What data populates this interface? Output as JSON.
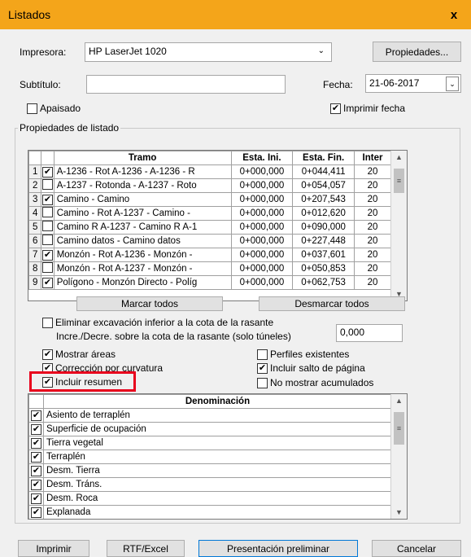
{
  "window": {
    "title": "Listados",
    "close_label": "x"
  },
  "printer": {
    "label": "Impresora:",
    "value": "HP LaserJet 1020",
    "properties_button": "Propiedades..."
  },
  "subtitle": {
    "label": "Subtítulo:",
    "value": ""
  },
  "date": {
    "label": "Fecha:",
    "value": "21-06-2017"
  },
  "landscape": {
    "label": "Apaisado",
    "checked": false
  },
  "print_date": {
    "label": "Imprimir fecha",
    "checked": true
  },
  "group_title": "Propiedades de listado",
  "tramo_table": {
    "headers": [
      "Tramo",
      "Esta. Ini.",
      "Esta. Fin.",
      "Inter"
    ],
    "rows": [
      {
        "n": "1",
        "checked": true,
        "tramo": "A-1236 - Rot A-1236 - A-1236 - R",
        "ini": "0+000,000",
        "fin": "0+044,411",
        "inter": "20"
      },
      {
        "n": "2",
        "checked": false,
        "tramo": "A-1237 - Rotonda - A-1237 - Roto",
        "ini": "0+000,000",
        "fin": "0+054,057",
        "inter": "20"
      },
      {
        "n": "3",
        "checked": true,
        "tramo": "Camino - Camino",
        "ini": "0+000,000",
        "fin": "0+207,543",
        "inter": "20"
      },
      {
        "n": "4",
        "checked": false,
        "tramo": "Camino - Rot A-1237 - Camino -",
        "ini": "0+000,000",
        "fin": "0+012,620",
        "inter": "20"
      },
      {
        "n": "5",
        "checked": false,
        "tramo": "Camino R A-1237 - Camino R A-1",
        "ini": "0+000,000",
        "fin": "0+090,000",
        "inter": "20"
      },
      {
        "n": "6",
        "checked": false,
        "tramo": "Camino datos - Camino datos",
        "ini": "0+000,000",
        "fin": "0+227,448",
        "inter": "20"
      },
      {
        "n": "7",
        "checked": true,
        "tramo": "Monzón - Rot A-1236 - Monzón -",
        "ini": "0+000,000",
        "fin": "0+037,601",
        "inter": "20"
      },
      {
        "n": "8",
        "checked": false,
        "tramo": "Monzón - Rot A-1237 - Monzón -",
        "ini": "0+000,000",
        "fin": "0+050,853",
        "inter": "20"
      },
      {
        "n": "9",
        "checked": true,
        "tramo": "Polígono - Monzón Directo - Políg",
        "ini": "0+000,000",
        "fin": "0+062,753",
        "inter": "20"
      }
    ]
  },
  "mark_all": "Marcar todos",
  "unmark_all": "Desmarcar todos",
  "excavation": {
    "line1": "Eliminar excavación inferior a la cota de la rasante",
    "line2": "Incre./Decre. sobre la cota de la rasante (solo túneles)",
    "value": "0,000",
    "checked": false
  },
  "options": {
    "show_areas": {
      "label": "Mostrar áreas",
      "checked": true
    },
    "curvature": {
      "label": "Corrección por curvatura",
      "checked": true
    },
    "summary": {
      "label": "Incluir resumen",
      "checked": true
    },
    "existing_profiles": {
      "label": "Perfiles existentes",
      "checked": false
    },
    "page_break": {
      "label": "Incluir salto de página",
      "checked": true
    },
    "no_cumulative": {
      "label": "No mostrar acumulados",
      "checked": false
    }
  },
  "denominacion_table": {
    "header": "Denominación",
    "rows": [
      {
        "label": "Asiento de terraplén",
        "checked": true
      },
      {
        "label": "Superficie de ocupación",
        "checked": true
      },
      {
        "label": "Tierra vegetal",
        "checked": true
      },
      {
        "label": "Terraplén",
        "checked": true
      },
      {
        "label": "Desm. Tierra",
        "checked": true
      },
      {
        "label": "Desm. Tráns.",
        "checked": true
      },
      {
        "label": "Desm. Roca",
        "checked": true
      },
      {
        "label": "Explanada",
        "checked": true
      }
    ]
  },
  "footer": {
    "print": "Imprimir",
    "rtf": "RTF/Excel",
    "preview": "Presentación preliminar",
    "cancel": "Cancelar"
  },
  "colors": {
    "titlebar": "#f4a51a",
    "highlight": "#e8001c"
  }
}
